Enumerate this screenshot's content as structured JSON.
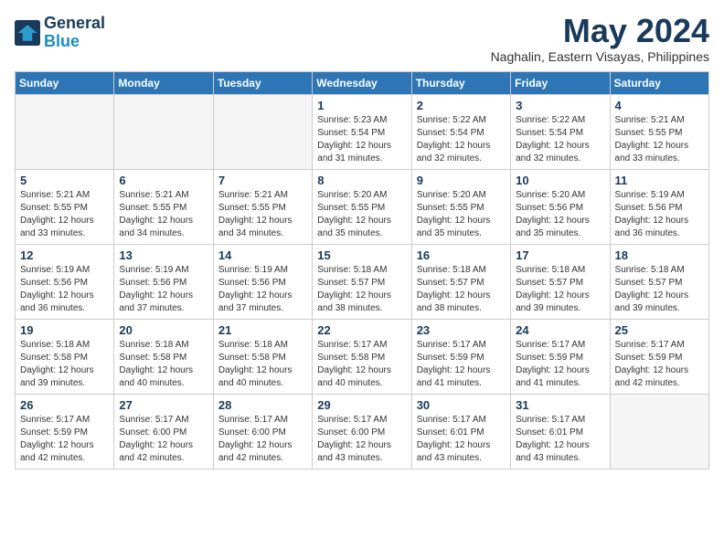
{
  "header": {
    "logo_line1": "General",
    "logo_line2": "Blue",
    "month_title": "May 2024",
    "subtitle": "Naghalin, Eastern Visayas, Philippines"
  },
  "weekdays": [
    "Sunday",
    "Monday",
    "Tuesday",
    "Wednesday",
    "Thursday",
    "Friday",
    "Saturday"
  ],
  "weeks": [
    [
      {
        "day": "",
        "info": ""
      },
      {
        "day": "",
        "info": ""
      },
      {
        "day": "",
        "info": ""
      },
      {
        "day": "1",
        "info": "Sunrise: 5:23 AM\nSunset: 5:54 PM\nDaylight: 12 hours\nand 31 minutes."
      },
      {
        "day": "2",
        "info": "Sunrise: 5:22 AM\nSunset: 5:54 PM\nDaylight: 12 hours\nand 32 minutes."
      },
      {
        "day": "3",
        "info": "Sunrise: 5:22 AM\nSunset: 5:54 PM\nDaylight: 12 hours\nand 32 minutes."
      },
      {
        "day": "4",
        "info": "Sunrise: 5:21 AM\nSunset: 5:55 PM\nDaylight: 12 hours\nand 33 minutes."
      }
    ],
    [
      {
        "day": "5",
        "info": "Sunrise: 5:21 AM\nSunset: 5:55 PM\nDaylight: 12 hours\nand 33 minutes."
      },
      {
        "day": "6",
        "info": "Sunrise: 5:21 AM\nSunset: 5:55 PM\nDaylight: 12 hours\nand 34 minutes."
      },
      {
        "day": "7",
        "info": "Sunrise: 5:21 AM\nSunset: 5:55 PM\nDaylight: 12 hours\nand 34 minutes."
      },
      {
        "day": "8",
        "info": "Sunrise: 5:20 AM\nSunset: 5:55 PM\nDaylight: 12 hours\nand 35 minutes."
      },
      {
        "day": "9",
        "info": "Sunrise: 5:20 AM\nSunset: 5:55 PM\nDaylight: 12 hours\nand 35 minutes."
      },
      {
        "day": "10",
        "info": "Sunrise: 5:20 AM\nSunset: 5:56 PM\nDaylight: 12 hours\nand 35 minutes."
      },
      {
        "day": "11",
        "info": "Sunrise: 5:19 AM\nSunset: 5:56 PM\nDaylight: 12 hours\nand 36 minutes."
      }
    ],
    [
      {
        "day": "12",
        "info": "Sunrise: 5:19 AM\nSunset: 5:56 PM\nDaylight: 12 hours\nand 36 minutes."
      },
      {
        "day": "13",
        "info": "Sunrise: 5:19 AM\nSunset: 5:56 PM\nDaylight: 12 hours\nand 37 minutes."
      },
      {
        "day": "14",
        "info": "Sunrise: 5:19 AM\nSunset: 5:56 PM\nDaylight: 12 hours\nand 37 minutes."
      },
      {
        "day": "15",
        "info": "Sunrise: 5:18 AM\nSunset: 5:57 PM\nDaylight: 12 hours\nand 38 minutes."
      },
      {
        "day": "16",
        "info": "Sunrise: 5:18 AM\nSunset: 5:57 PM\nDaylight: 12 hours\nand 38 minutes."
      },
      {
        "day": "17",
        "info": "Sunrise: 5:18 AM\nSunset: 5:57 PM\nDaylight: 12 hours\nand 39 minutes."
      },
      {
        "day": "18",
        "info": "Sunrise: 5:18 AM\nSunset: 5:57 PM\nDaylight: 12 hours\nand 39 minutes."
      }
    ],
    [
      {
        "day": "19",
        "info": "Sunrise: 5:18 AM\nSunset: 5:58 PM\nDaylight: 12 hours\nand 39 minutes."
      },
      {
        "day": "20",
        "info": "Sunrise: 5:18 AM\nSunset: 5:58 PM\nDaylight: 12 hours\nand 40 minutes."
      },
      {
        "day": "21",
        "info": "Sunrise: 5:18 AM\nSunset: 5:58 PM\nDaylight: 12 hours\nand 40 minutes."
      },
      {
        "day": "22",
        "info": "Sunrise: 5:17 AM\nSunset: 5:58 PM\nDaylight: 12 hours\nand 40 minutes."
      },
      {
        "day": "23",
        "info": "Sunrise: 5:17 AM\nSunset: 5:59 PM\nDaylight: 12 hours\nand 41 minutes."
      },
      {
        "day": "24",
        "info": "Sunrise: 5:17 AM\nSunset: 5:59 PM\nDaylight: 12 hours\nand 41 minutes."
      },
      {
        "day": "25",
        "info": "Sunrise: 5:17 AM\nSunset: 5:59 PM\nDaylight: 12 hours\nand 42 minutes."
      }
    ],
    [
      {
        "day": "26",
        "info": "Sunrise: 5:17 AM\nSunset: 5:59 PM\nDaylight: 12 hours\nand 42 minutes."
      },
      {
        "day": "27",
        "info": "Sunrise: 5:17 AM\nSunset: 6:00 PM\nDaylight: 12 hours\nand 42 minutes."
      },
      {
        "day": "28",
        "info": "Sunrise: 5:17 AM\nSunset: 6:00 PM\nDaylight: 12 hours\nand 42 minutes."
      },
      {
        "day": "29",
        "info": "Sunrise: 5:17 AM\nSunset: 6:00 PM\nDaylight: 12 hours\nand 43 minutes."
      },
      {
        "day": "30",
        "info": "Sunrise: 5:17 AM\nSunset: 6:01 PM\nDaylight: 12 hours\nand 43 minutes."
      },
      {
        "day": "31",
        "info": "Sunrise: 5:17 AM\nSunset: 6:01 PM\nDaylight: 12 hours\nand 43 minutes."
      },
      {
        "day": "",
        "info": ""
      }
    ]
  ]
}
